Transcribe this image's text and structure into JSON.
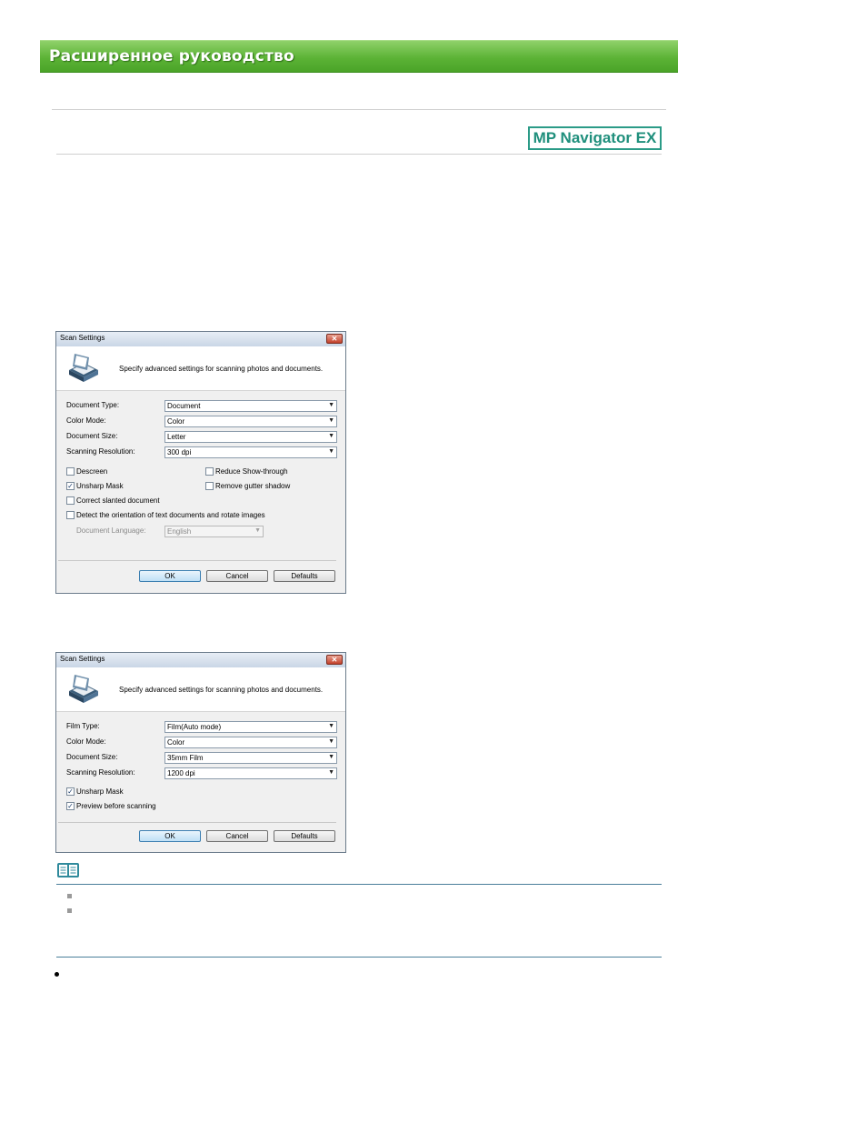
{
  "header": {
    "title": "Расширенное руководство"
  },
  "logo": {
    "label": "MP Navigator EX"
  },
  "dialog1": {
    "title": "Scan Settings",
    "close_label": "✕",
    "header_text": "Specify advanced settings for scanning photos and documents.",
    "fields": [
      {
        "label": "Document Type:",
        "value": "Document"
      },
      {
        "label": "Color Mode:",
        "value": "Color"
      },
      {
        "label": "Document Size:",
        "value": "Letter"
      },
      {
        "label": "Scanning Resolution:",
        "value": "300 dpi"
      }
    ],
    "checkboxes": [
      {
        "label": "Descreen",
        "checked": false
      },
      {
        "label": "Reduce Show-through",
        "checked": false
      },
      {
        "label": "Unsharp Mask",
        "checked": true
      },
      {
        "label": "Remove gutter shadow",
        "checked": false
      },
      {
        "label": "Correct slanted document",
        "checked": false
      },
      {
        "label": "Detect the orientation of text documents and rotate images",
        "checked": false
      }
    ],
    "language_label": "Document Language:",
    "language_value": "English",
    "buttons": {
      "ok": "OK",
      "cancel": "Cancel",
      "defaults": "Defaults"
    }
  },
  "dialog2": {
    "title": "Scan Settings",
    "close_label": "✕",
    "header_text": "Specify advanced settings for scanning photos and documents.",
    "fields": [
      {
        "label": "Film Type:",
        "value": "Film(Auto mode)"
      },
      {
        "label": "Color Mode:",
        "value": "Color"
      },
      {
        "label": "Document Size:",
        "value": "35mm Film"
      },
      {
        "label": "Scanning Resolution:",
        "value": "1200 dpi"
      }
    ],
    "checkboxes": [
      {
        "label": "Unsharp Mask",
        "checked": true
      },
      {
        "label": "Preview before scanning",
        "checked": true
      }
    ],
    "buttons": {
      "ok": "OK",
      "cancel": "Cancel",
      "defaults": "Defaults"
    }
  },
  "icons": {
    "note": "note-book-icon",
    "scanner": "scanner-icon",
    "dropdown": "chevron-down-icon"
  },
  "colors": {
    "banner": "#5cb336",
    "logo": "#2b9b87",
    "note_rule": "#4a7f9a"
  }
}
